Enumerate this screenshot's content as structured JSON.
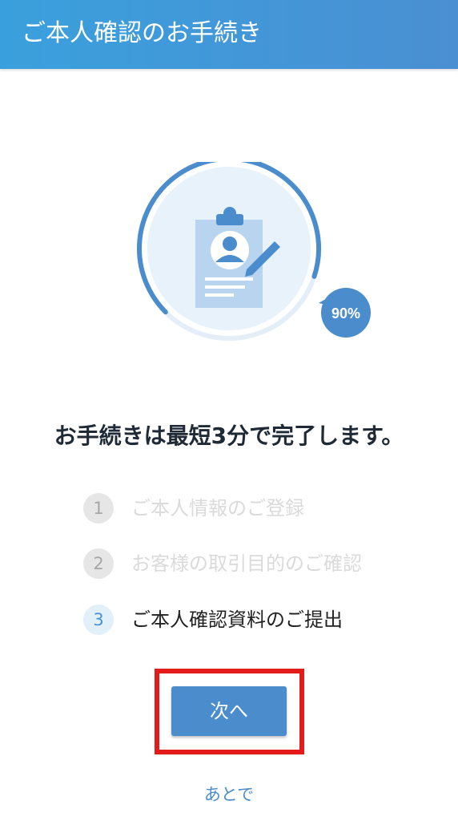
{
  "header": {
    "title": "ご本人確認のお手続き"
  },
  "illustration": {
    "progress_percent": 90,
    "progress_label": "90%",
    "icon": "clipboard-profile-icon"
  },
  "main": {
    "headline": "お手続きは最短3分で完了します。",
    "steps": [
      {
        "number": "1",
        "label": "ご本人情報のご登録",
        "state": "done"
      },
      {
        "number": "2",
        "label": "お客様の取引目的のご確認",
        "state": "done"
      },
      {
        "number": "3",
        "label": "ご本人確認資料のご提出",
        "state": "active"
      }
    ],
    "next_button_label": "次へ",
    "later_link_label": "あとで"
  },
  "colors": {
    "header_gradient_start": "#3aa0dd",
    "header_gradient_end": "#4a8fd2",
    "accent": "#4b8ccd",
    "highlight": "#e41b1b"
  }
}
